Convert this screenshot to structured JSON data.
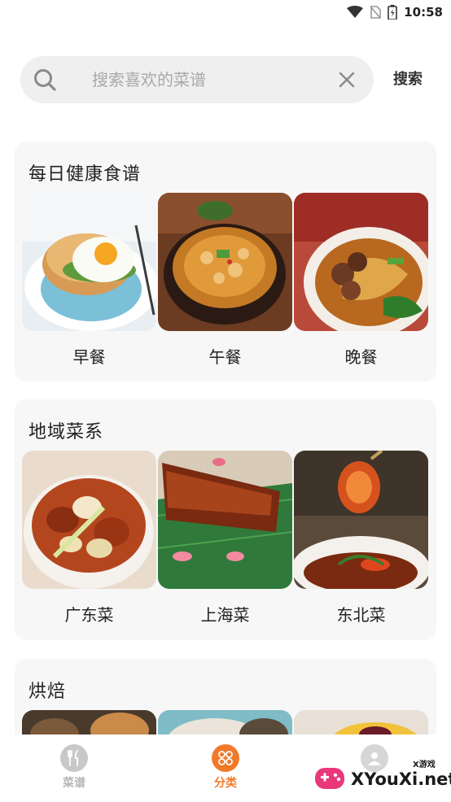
{
  "status_bar": {
    "time": "10:58"
  },
  "search": {
    "placeholder": "搜索喜欢的菜谱",
    "value": "",
    "button_label": "搜索"
  },
  "sections": [
    {
      "title": "每日健康食谱",
      "items": [
        {
          "label": "早餐"
        },
        {
          "label": "午餐"
        },
        {
          "label": "晚餐"
        }
      ]
    },
    {
      "title": "地域菜系",
      "items": [
        {
          "label": "广东菜"
        },
        {
          "label": "上海菜"
        },
        {
          "label": "东北菜"
        }
      ]
    },
    {
      "title": "烘焙"
    }
  ],
  "bottom_nav": {
    "items": [
      {
        "label": "菜谱",
        "active": false
      },
      {
        "label": "分类",
        "active": true
      }
    ],
    "accent_color": "#f07a2a"
  },
  "watermark": {
    "text": "XYouXi.net",
    "small": "X游戏"
  }
}
